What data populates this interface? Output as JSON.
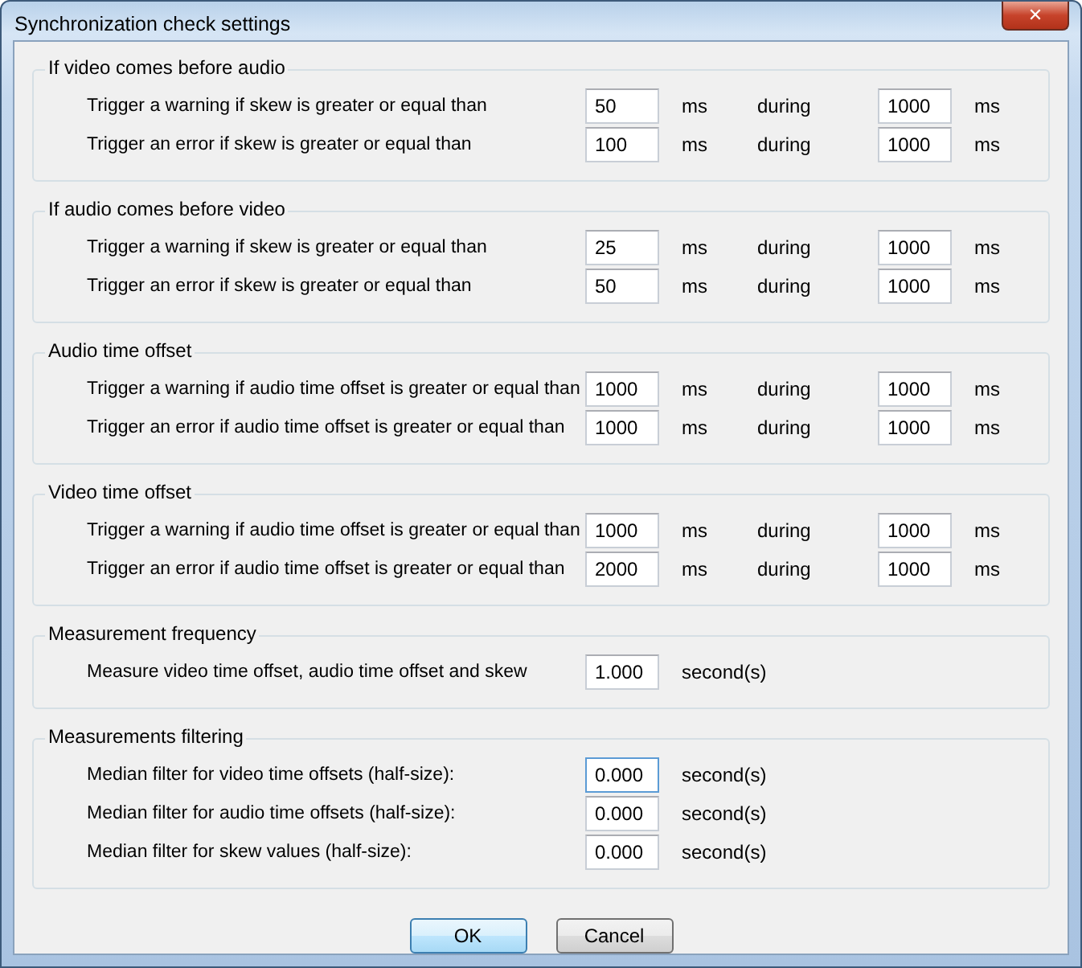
{
  "window": {
    "title": "Synchronization check settings",
    "close": "✕"
  },
  "groups": [
    {
      "title": "If video comes before audio",
      "rows": [
        {
          "kind": "range",
          "label": "Trigger a warning if skew is greater or equal than",
          "value": "50",
          "unit": "ms",
          "during": "during",
          "duration": "1000",
          "duration_unit": "ms"
        },
        {
          "kind": "range",
          "label": "Trigger an error if skew is greater or equal than",
          "value": "100",
          "unit": "ms",
          "during": "during",
          "duration": "1000",
          "duration_unit": "ms"
        }
      ]
    },
    {
      "title": "If audio comes before video",
      "rows": [
        {
          "kind": "range",
          "label": "Trigger a warning if skew is greater or equal than",
          "value": "25",
          "unit": "ms",
          "during": "during",
          "duration": "1000",
          "duration_unit": "ms"
        },
        {
          "kind": "range",
          "label": "Trigger an error if skew is greater or equal than",
          "value": "50",
          "unit": "ms",
          "during": "during",
          "duration": "1000",
          "duration_unit": "ms"
        }
      ]
    },
    {
      "title": "Audio time offset",
      "rows": [
        {
          "kind": "range",
          "label": "Trigger a warning if audio time offset is greater or equal than",
          "value": "1000",
          "unit": "ms",
          "during": "during",
          "duration": "1000",
          "duration_unit": "ms"
        },
        {
          "kind": "range",
          "label": "Trigger an error if audio time offset is greater or equal than",
          "value": "1000",
          "unit": "ms",
          "during": "during",
          "duration": "1000",
          "duration_unit": "ms"
        }
      ]
    },
    {
      "title": "Video time offset",
      "rows": [
        {
          "kind": "range",
          "label": "Trigger a warning if audio time offset is greater or equal than",
          "value": "1000",
          "unit": "ms",
          "during": "during",
          "duration": "1000",
          "duration_unit": "ms"
        },
        {
          "kind": "range",
          "label": "Trigger an error if audio time offset is greater or equal than",
          "value": "2000",
          "unit": "ms",
          "during": "during",
          "duration": "1000",
          "duration_unit": "ms"
        }
      ]
    },
    {
      "title": "Measurement frequency",
      "rows": [
        {
          "kind": "single",
          "label": "Measure video time offset, audio time offset and skew",
          "value": "1.000",
          "unit": "second(s)"
        }
      ]
    },
    {
      "title": "Measurements filtering",
      "rows": [
        {
          "kind": "single",
          "label": "Median filter for video time offsets (half-size):",
          "value": "0.000",
          "unit": "second(s)",
          "focused": true
        },
        {
          "kind": "single",
          "label": "Median filter for audio time offsets (half-size):",
          "value": "0.000",
          "unit": "second(s)",
          "focused": false
        },
        {
          "kind": "single",
          "label": "Median filter for skew values (half-size):",
          "value": "0.000",
          "unit": "second(s)",
          "focused": false
        }
      ]
    }
  ],
  "buttons": [
    {
      "label": "OK",
      "default": true
    },
    {
      "label": "Cancel",
      "default": false
    }
  ]
}
